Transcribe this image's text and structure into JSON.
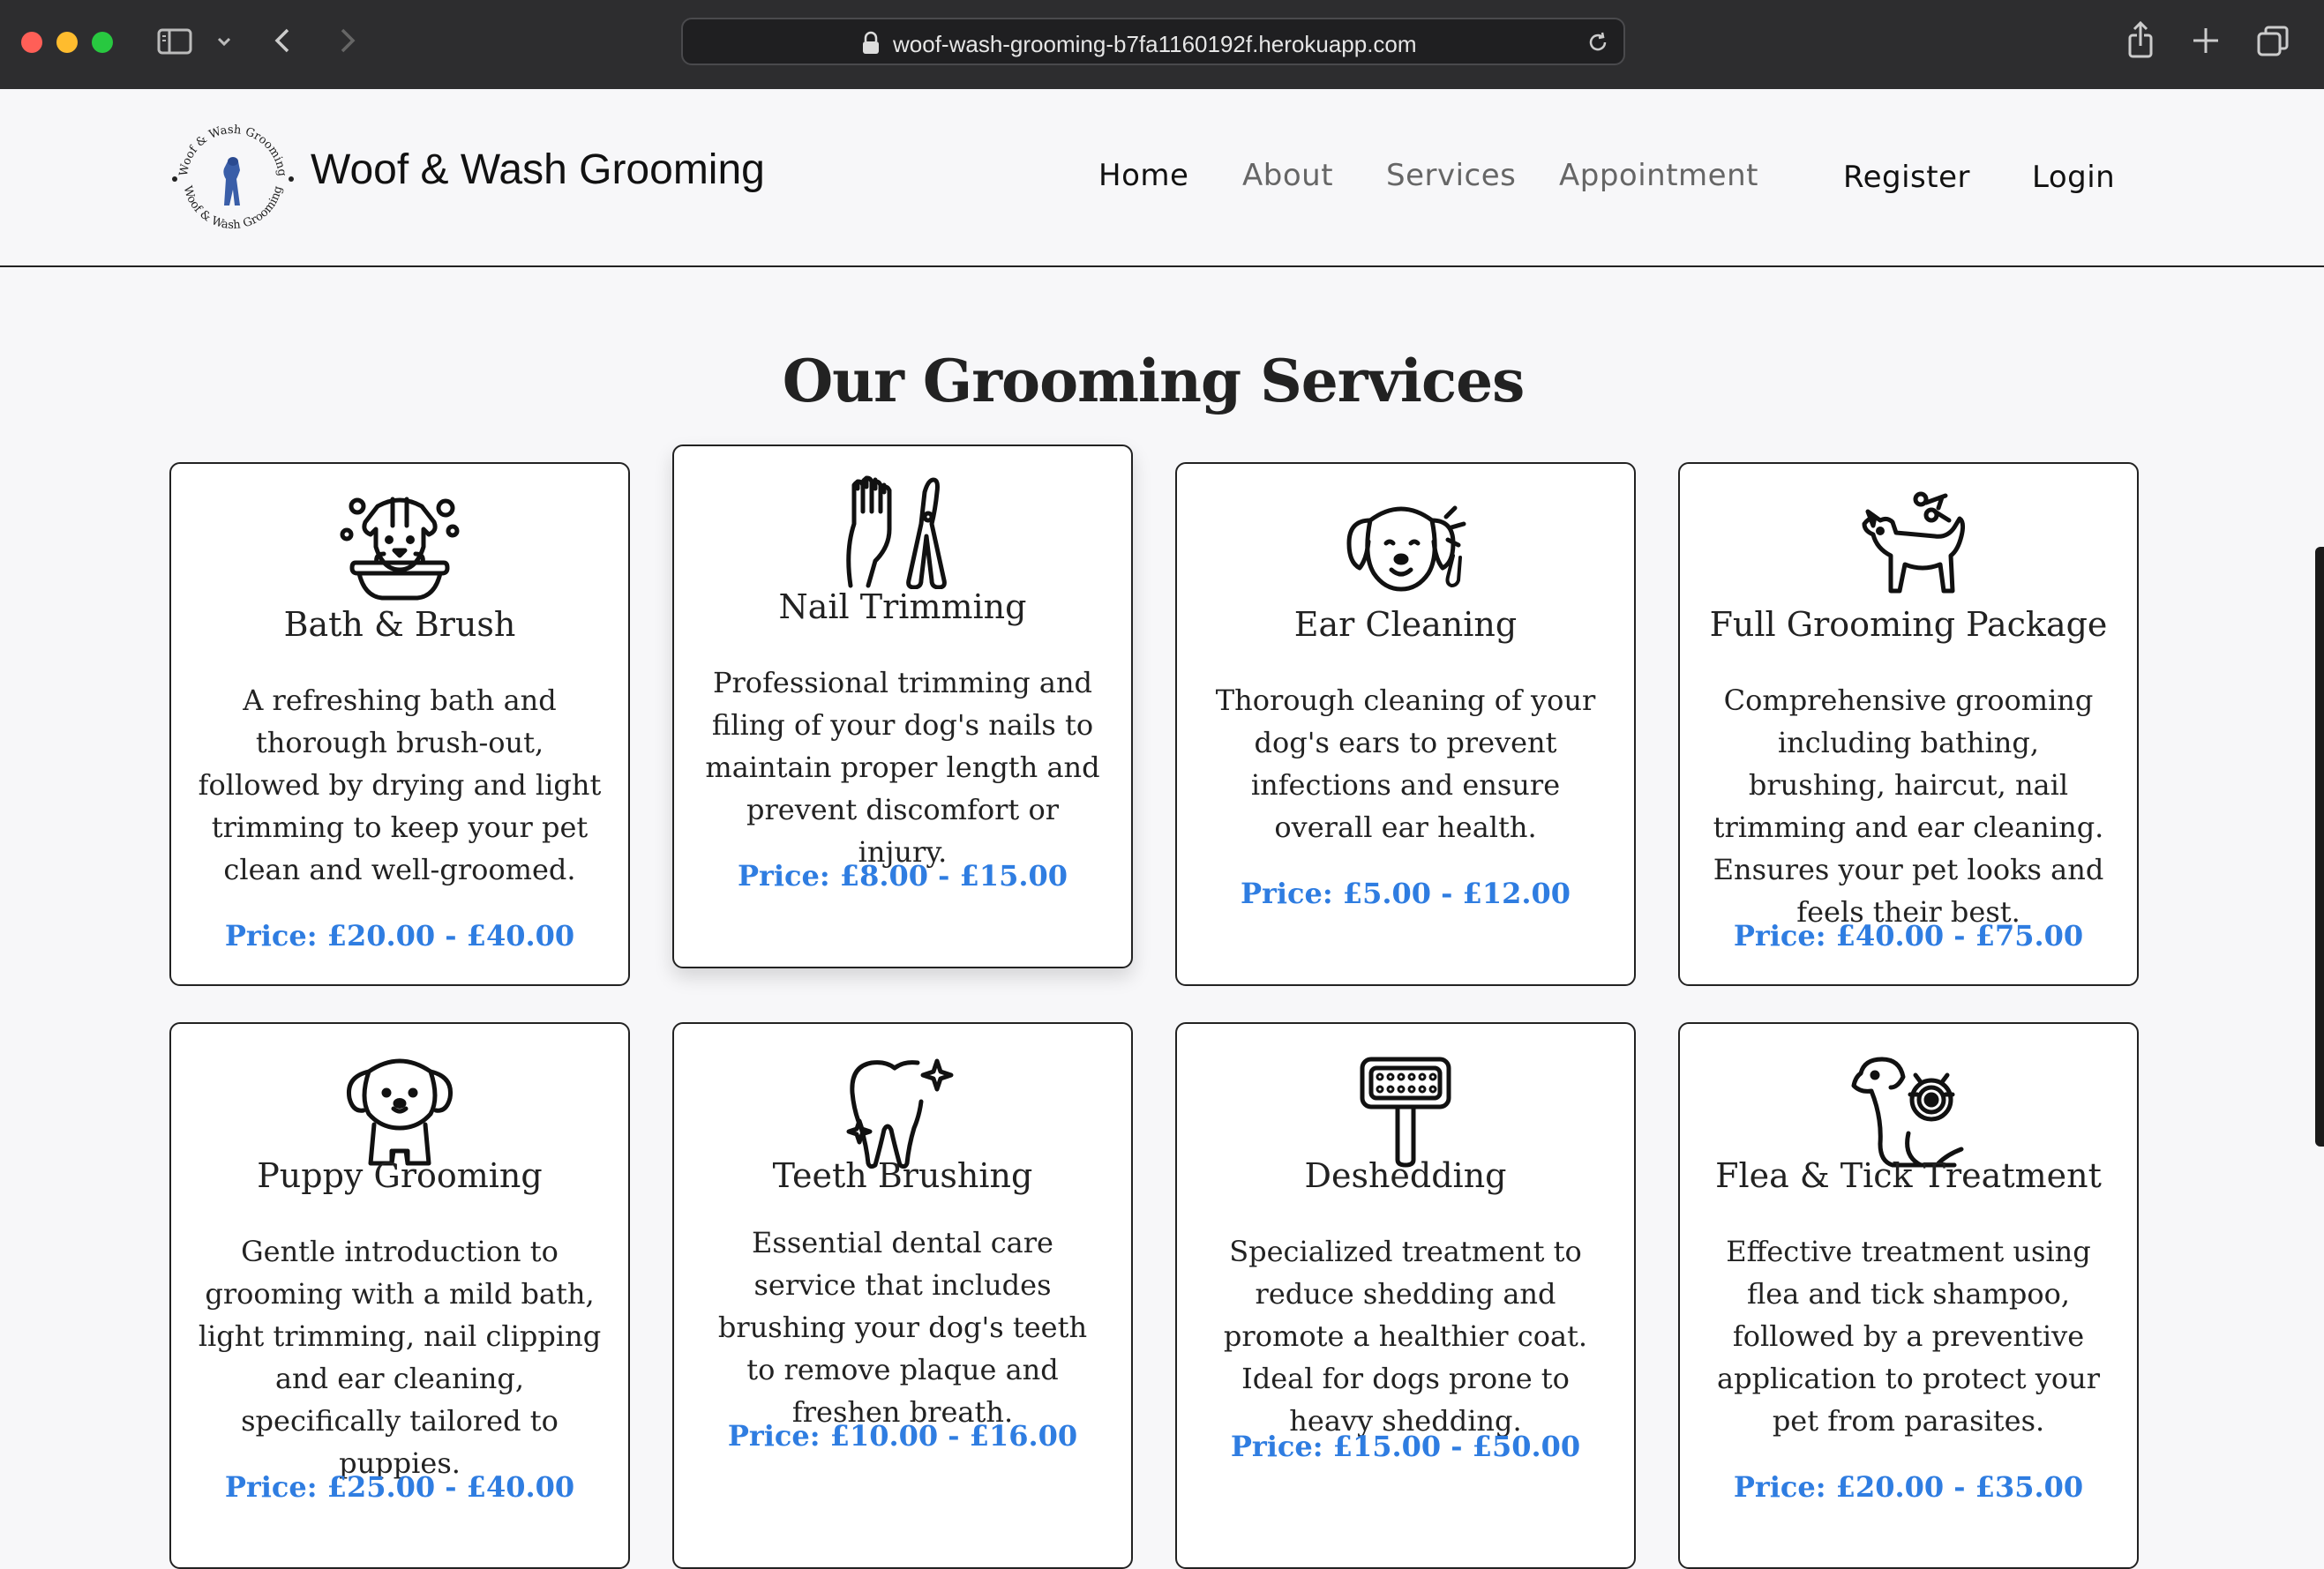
{
  "browser": {
    "url": "woof-wash-grooming-b7fa1160192f.herokuapp.com"
  },
  "header": {
    "brand": "Woof & Wash Grooming",
    "logo_text": "Woof & Wash Grooming",
    "nav": {
      "home": "Home",
      "about": "About",
      "services": "Services",
      "appointment": "Appointment",
      "register": "Register",
      "login": "Login"
    }
  },
  "main": {
    "title": "Our Grooming Services",
    "services": [
      {
        "icon": "dog-bath-icon",
        "name": "Bath & Brush",
        "description": "A refreshing bath and thorough brush-out, followed by drying and light trimming to keep your pet clean and well-groomed.",
        "price": "Price: £20.00 - £40.00"
      },
      {
        "icon": "nail-clipper-icon",
        "name": "Nail Trimming",
        "description": "Professional trimming and filing of your dog's nails to maintain proper length and prevent discomfort or injury.",
        "price": "Price: £8.00 - £15.00"
      },
      {
        "icon": "dog-ear-icon",
        "name": "Ear Cleaning",
        "description": "Thorough cleaning of your dog's ears to prevent infections and ensure overall ear health.",
        "price": "Price: £5.00 - £12.00"
      },
      {
        "icon": "dog-scissors-icon",
        "name": "Full Grooming Package",
        "description": "Comprehensive grooming including bathing, brushing, haircut, nail trimming and ear cleaning. Ensures your pet looks and feels their best.",
        "price": "Price: £40.00 - £75.00"
      },
      {
        "icon": "puppy-icon",
        "name": "Puppy Grooming",
        "description": "Gentle introduction to grooming with a mild bath, light trimming, nail clipping and ear cleaning, specifically tailored to puppies.",
        "price": "Price: £25.00 - £40.00"
      },
      {
        "icon": "tooth-sparkle-icon",
        "name": "Teeth Brushing",
        "description": "Essential dental care service that includes brushing your dog's teeth to remove plaque and freshen breath.",
        "price": "Price: £10.00 - £16.00"
      },
      {
        "icon": "deshedding-brush-icon",
        "name": "Deshedding",
        "description": "Specialized treatment to reduce shedding and promote a healthier coat. Ideal for dogs prone to heavy shedding.",
        "price": "Price: £15.00 - £50.00"
      },
      {
        "icon": "dog-flea-icon",
        "name": "Flea & Tick Treatment",
        "description": "Effective treatment using flea and tick shampoo, followed by a preventive application to protect your pet from parasites.",
        "price": "Price: £20.00 - £35.00"
      }
    ]
  }
}
